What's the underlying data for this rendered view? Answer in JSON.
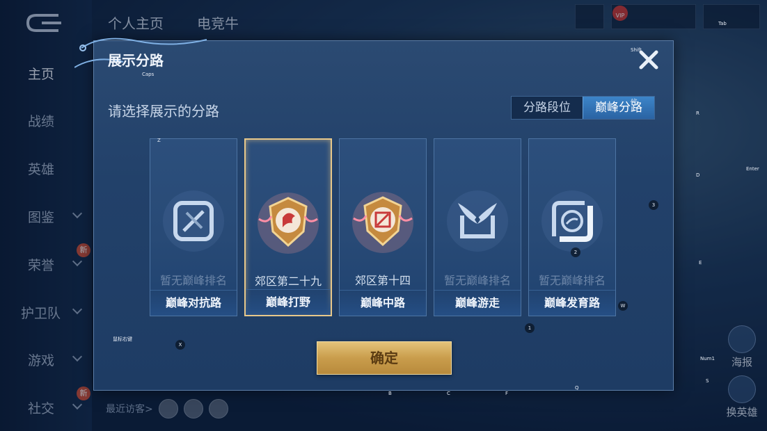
{
  "nav": {
    "items": [
      {
        "label": "主页",
        "active": true
      },
      {
        "label": "战绩"
      },
      {
        "label": "英雄"
      },
      {
        "label": "图鉴"
      },
      {
        "label": "荣誉"
      },
      {
        "label": "护卫队"
      },
      {
        "label": "游戏"
      },
      {
        "label": "社交"
      }
    ],
    "new_badge": "新"
  },
  "top_tabs": [
    "个人主页",
    "电竞牛"
  ],
  "visitors_label": "最近访客>",
  "right_buttons": {
    "poster": "海报",
    "change_hero": "换英雄"
  },
  "dialog": {
    "title": "展示分路",
    "subtitle": "请选择展示的分路",
    "toggle": {
      "options": [
        "分路段位",
        "巅峰分路"
      ],
      "selected": "巅峰分路"
    },
    "cards": [
      {
        "role": "巅峰对抗路",
        "rank": "暂无巅峰排名",
        "has_rank": false,
        "icon": "sword-slash-icon"
      },
      {
        "role": "巅峰打野",
        "rank": "郊区第二十九",
        "has_rank": true,
        "icon": "jungle-emblem-icon",
        "selected": true
      },
      {
        "role": "巅峰中路",
        "rank": "郊区第十四",
        "has_rank": true,
        "icon": "mid-emblem-icon"
      },
      {
        "role": "巅峰游走",
        "rank": "暂无巅峰排名",
        "has_rank": false,
        "icon": "wings-icon"
      },
      {
        "role": "巅峰发育路",
        "rank": "暂无巅峰排名",
        "has_rank": false,
        "icon": "marksman-icon"
      }
    ],
    "confirm_label": "确定"
  },
  "key_hints": {
    "shift": "Shift",
    "tab": "Tab",
    "caps": "Caps",
    "alt": "Alt",
    "r": "R",
    "z": "Z",
    "enter": "Enter",
    "d": "D",
    "three": "3",
    "two": "2",
    "e": "E",
    "w": "W",
    "one": "1",
    "mouse_right": "鼠标右键",
    "x": "X",
    "num1": "Num1",
    "s": "S",
    "b": "B",
    "c": "C",
    "f": "F",
    "q": "Q"
  },
  "colors": {
    "accent_blue": "#2a63a3",
    "confirm_gold": "#c99d4c",
    "selected_border": "#e8c88a"
  }
}
